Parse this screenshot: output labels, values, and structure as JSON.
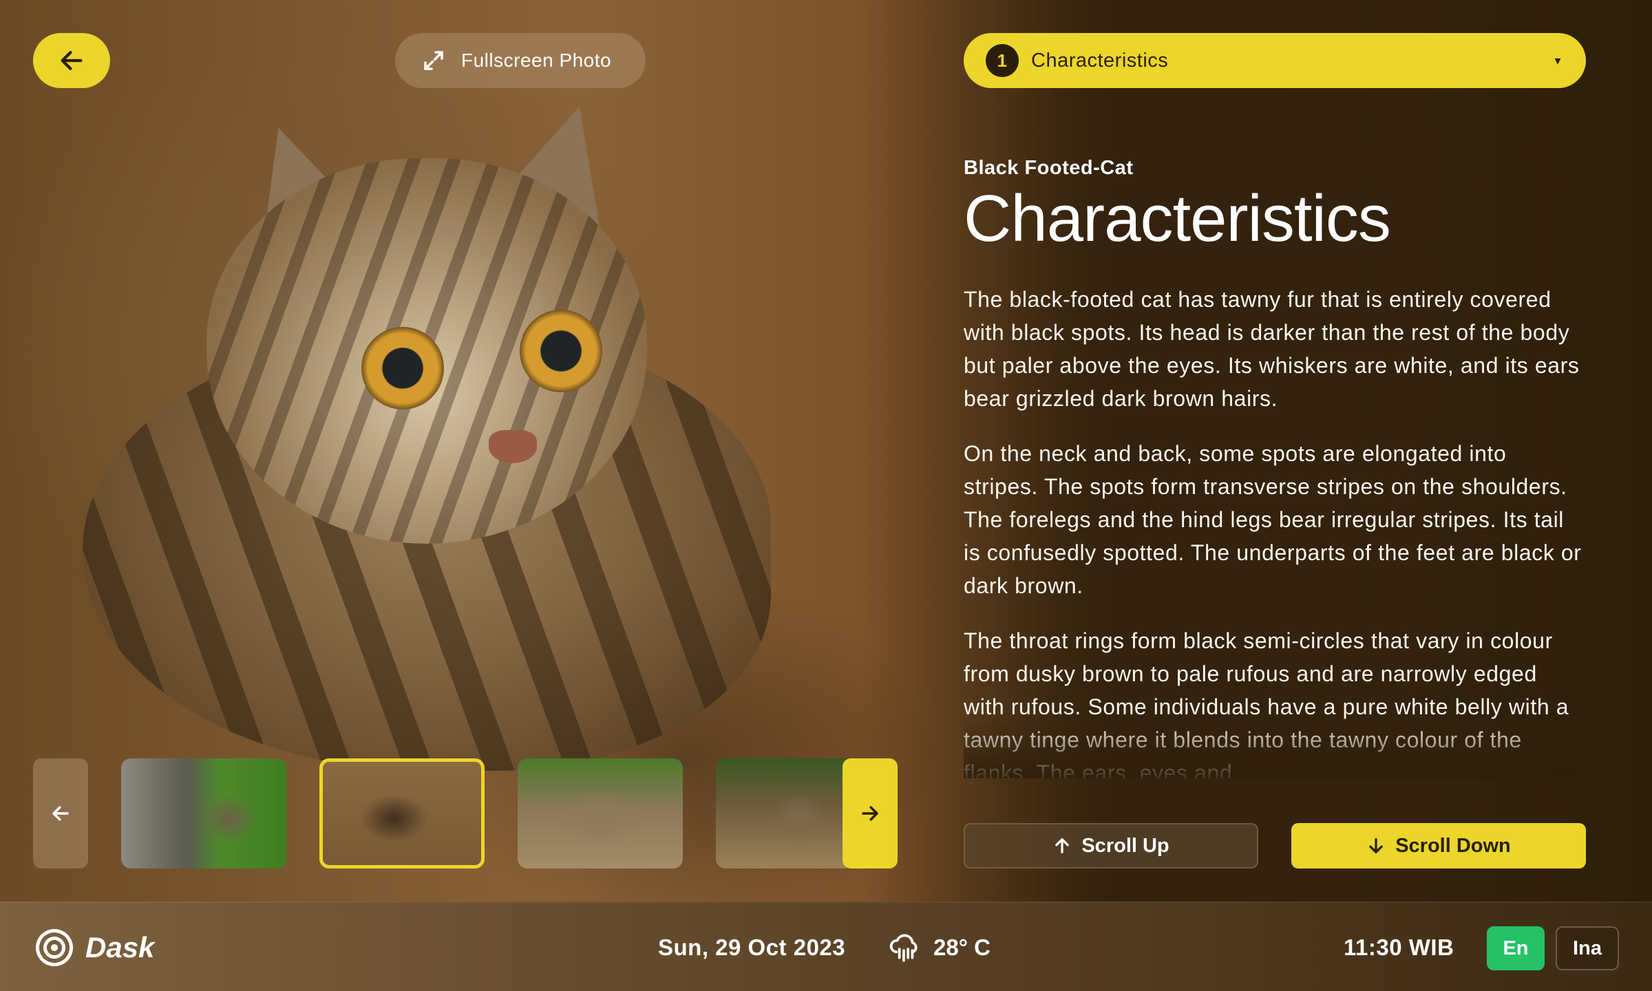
{
  "top": {
    "back_icon": "arrow-left-icon",
    "fullscreen_label": "Fullscreen Photo",
    "fullscreen_icon": "expand-icon",
    "section_select": {
      "number": "1",
      "selected": "Characteristics",
      "caret": "▾"
    }
  },
  "article": {
    "subtitle": "Black Footed-Cat",
    "title": "Characteristics",
    "paragraphs": [
      "The black-footed cat has tawny fur that is entirely covered with black spots. Its head is darker than the rest of the body but paler above the eyes. Its whiskers are white, and its ears bear grizzled dark brown hairs.",
      "On the neck and back, some spots are elongated into stripes. The spots form transverse stripes on the shoulders. The forelegs and the hind legs bear irregular stripes. Its tail is confusedly spotted. The underparts of the feet are black or dark brown.",
      "The throat rings form black semi-circles that vary in colour from dusky brown to pale rufous and are narrowly edged with rufous. Some individuals have a pure white belly with a tawny tinge where it blends into the tawny colour of the flanks. The ears, eyes and"
    ]
  },
  "scroll": {
    "up_label": "Scroll Up",
    "down_label": "Scroll Down"
  },
  "gallery": {
    "prev_icon": "arrow-left-icon",
    "next_icon": "arrow-right-icon",
    "thumbnails": [
      "thumbnail-1",
      "thumbnail-2",
      "thumbnail-3",
      "thumbnail-4"
    ],
    "selected_index": 1
  },
  "footer": {
    "brand": "Dask",
    "date": "Sun, 29 Oct 2023",
    "weather_icon": "rain-cloud-icon",
    "temperature": "28° C",
    "time": "11:30 WIB",
    "languages": [
      "En",
      "Ina"
    ],
    "active_language": "En"
  },
  "colors": {
    "accent": "#ecd62a",
    "active_language": "#25c266",
    "background": "#2e1f0c"
  }
}
